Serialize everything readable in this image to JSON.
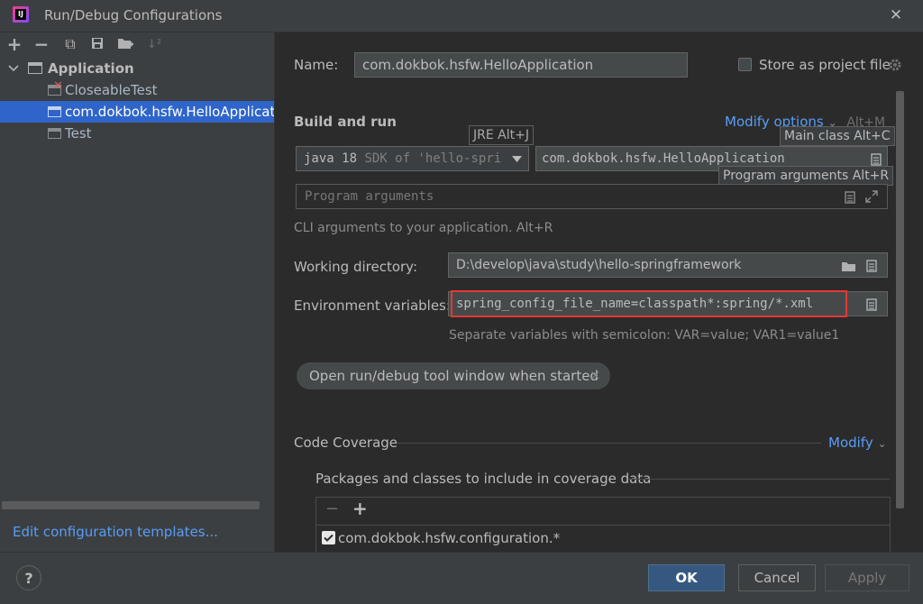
{
  "window": {
    "title": "Run/Debug Configurations",
    "close_glyph": "✕",
    "app_icon_text": "IJ"
  },
  "toolbar": {
    "add": "+",
    "remove": "−",
    "copy": "⧉",
    "save": "💾",
    "folder": "📁",
    "sort": "↓²"
  },
  "tree": {
    "application_label": "Application",
    "items": [
      {
        "label": "CloseableTest",
        "error": true
      },
      {
        "label": "com.dokbok.hsfw.HelloApplication",
        "selected": true
      },
      {
        "label": "Test"
      }
    ]
  },
  "left_footer": {
    "templates_link": "Edit configuration templates..."
  },
  "name_row": {
    "label": "Name:",
    "value": "com.dokbok.hsfw.HelloApplication",
    "store_label": "Store as project file"
  },
  "build_run": {
    "heading": "Build and run",
    "modify_options": "Modify options",
    "modify_shortcut": "Alt+M",
    "jre_tip": "JRE Alt+J",
    "jdk_value": "java 18",
    "jdk_detail": "SDK of 'hello-spri",
    "main_class_value": "com.dokbok.hsfw.HelloApplication",
    "main_class_tip": "Main class Alt+C",
    "program_args_tip": "Program arguments Alt+R",
    "program_args_placeholder": "Program arguments",
    "cli_hint": "CLI arguments to your application. Alt+R"
  },
  "working_dir": {
    "label": "Working directory:",
    "value": "D:\\develop\\java\\study\\hello-springframework"
  },
  "env_vars": {
    "label": "Environment variables:",
    "value": "spring_config_file_name=classpath*:spring/*.xml",
    "hint": "Separate variables with semicolon: VAR=value; VAR1=value1"
  },
  "chip": {
    "label": "Open run/debug tool window when started",
    "close": "×"
  },
  "coverage": {
    "heading": "Code Coverage",
    "modify": "Modify",
    "packages_label": "Packages and classes to include in coverage data",
    "minus": "−",
    "plus": "+",
    "entry": "com.dokbok.hsfw.configuration.*"
  },
  "footer": {
    "help": "?",
    "ok": "OK",
    "cancel": "Cancel",
    "apply": "Apply"
  },
  "colors": {
    "background": "#2b2b2b",
    "panel": "#3c3f41",
    "selection": "#2f65ca",
    "link": "#589df6",
    "error": "#db5c5c",
    "highlight_border": "#e53935"
  }
}
